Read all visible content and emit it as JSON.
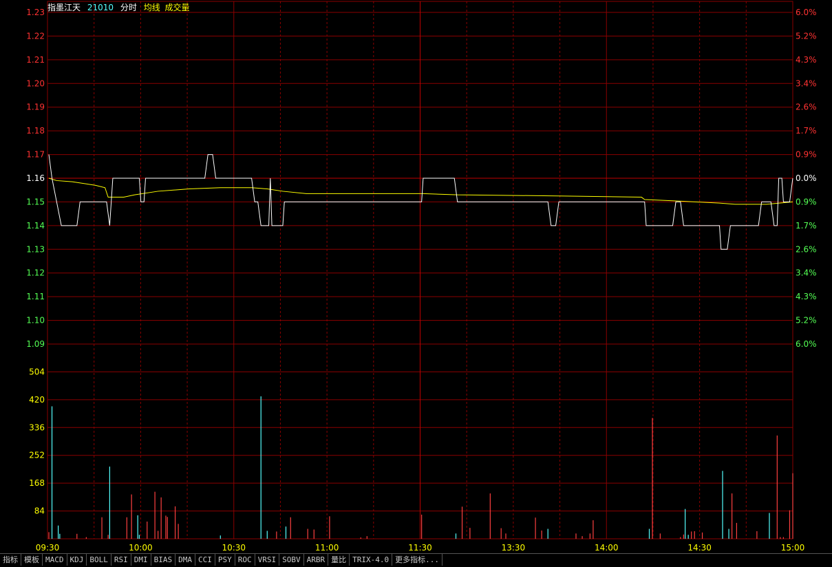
{
  "header": {
    "name": "指墨江天",
    "code": "21010",
    "mode": "分时",
    "avg_label": "均线",
    "vol_label": "成交量"
  },
  "colors": {
    "up": "#ff3232",
    "down": "#54ff54",
    "flat": "#ffffff",
    "grid": "#8b0000",
    "price_line": "#ffffff",
    "avg_line": "#ffff00",
    "vol_up": "#ff4040",
    "vol_down": "#54ffff",
    "vol_label": "#ffff00",
    "time_label": "#ffff00"
  },
  "toolbar": [
    "指标",
    "模板",
    "MACD",
    "KDJ",
    "BOLL",
    "RSI",
    "DMI",
    "BIAS",
    "DMA",
    "CCI",
    "PSY",
    "ROC",
    "VRSI",
    "SOBV",
    "ARBR",
    "量比",
    "TRIX-4.0",
    "更多指标..."
  ],
  "chart_data": {
    "type": "line",
    "title": "指墨江天 21010 分时",
    "prev_close": 1.16,
    "price_axis": {
      "ticks": [
        "1.23",
        "1.22",
        "1.21",
        "1.20",
        "1.19",
        "1.18",
        "1.17",
        "1.16",
        "1.15",
        "1.14",
        "1.13",
        "1.12",
        "1.11",
        "1.10",
        "1.09"
      ],
      "range": [
        1.09,
        1.23
      ]
    },
    "pct_axis": {
      "ticks": [
        "6.0%",
        "5.2%",
        "4.3%",
        "3.4%",
        "2.6%",
        "1.7%",
        "0.9%",
        "0.0%",
        "0.9%",
        "1.7%",
        "2.6%",
        "3.4%",
        "4.3%",
        "5.2%",
        "6.0%"
      ]
    },
    "volume_axis": {
      "ticks": [
        "504",
        "420",
        "336",
        "252",
        "168",
        "84"
      ],
      "range": [
        0,
        588
      ]
    },
    "time_labels": [
      "09:30",
      "10:00",
      "10:30",
      "11:00",
      "11:30",
      "13:30",
      "14:00",
      "14:30",
      "15:00"
    ],
    "price_points": [
      [
        0,
        1.17
      ],
      [
        2,
        1.16
      ],
      [
        5,
        1.15
      ],
      [
        8,
        1.14
      ],
      [
        18,
        1.14
      ],
      [
        20,
        1.15
      ],
      [
        37,
        1.15
      ],
      [
        39,
        1.14
      ],
      [
        41,
        1.16
      ],
      [
        58,
        1.16
      ],
      [
        59,
        1.15
      ],
      [
        61,
        1.15
      ],
      [
        62,
        1.16
      ],
      [
        100,
        1.16
      ],
      [
        102,
        1.17
      ],
      [
        105,
        1.17
      ],
      [
        107,
        1.16
      ],
      [
        130,
        1.16
      ],
      [
        132,
        1.15
      ],
      [
        134,
        1.15
      ],
      [
        136,
        1.14
      ],
      [
        141,
        1.14
      ],
      [
        142,
        1.16
      ],
      [
        143,
        1.14
      ],
      [
        150,
        1.14
      ],
      [
        151,
        1.15
      ],
      [
        157,
        1.15
      ],
      [
        158,
        1.15
      ],
      [
        239,
        1.15
      ],
      [
        240,
        1.16
      ],
      [
        260,
        1.16
      ],
      [
        262,
        1.15
      ],
      [
        320,
        1.15
      ],
      [
        322,
        1.14
      ],
      [
        325,
        1.14
      ],
      [
        327,
        1.15
      ],
      [
        382,
        1.15
      ],
      [
        383,
        1.14
      ],
      [
        400,
        1.14
      ],
      [
        402,
        1.15
      ],
      [
        405,
        1.15
      ],
      [
        407,
        1.14
      ],
      [
        430,
        1.14
      ],
      [
        431,
        1.13
      ],
      [
        435,
        1.13
      ],
      [
        437,
        1.14
      ],
      [
        455,
        1.14
      ],
      [
        457,
        1.15
      ],
      [
        463,
        1.15
      ],
      [
        465,
        1.14
      ],
      [
        467,
        1.14
      ],
      [
        468,
        1.16
      ],
      [
        470,
        1.16
      ],
      [
        471,
        1.15
      ],
      [
        475,
        1.15
      ],
      [
        477,
        1.16
      ]
    ],
    "avg_points": [
      [
        0,
        1.16
      ],
      [
        5,
        1.159
      ],
      [
        15,
        1.1585
      ],
      [
        30,
        1.157
      ],
      [
        36,
        1.156
      ],
      [
        38,
        1.152
      ],
      [
        48,
        1.152
      ],
      [
        55,
        1.153
      ],
      [
        70,
        1.1545
      ],
      [
        90,
        1.1555
      ],
      [
        110,
        1.156
      ],
      [
        130,
        1.156
      ],
      [
        140,
        1.1555
      ],
      [
        150,
        1.1545
      ],
      [
        165,
        1.1535
      ],
      [
        240,
        1.1535
      ],
      [
        262,
        1.153
      ],
      [
        330,
        1.1525
      ],
      [
        380,
        1.152
      ],
      [
        382,
        1.151
      ],
      [
        400,
        1.1505
      ],
      [
        430,
        1.1495
      ],
      [
        440,
        1.149
      ],
      [
        460,
        1.149
      ],
      [
        477,
        1.15
      ]
    ],
    "volume_bars": [
      [
        0,
        20,
        "up"
      ],
      [
        2,
        400,
        "down"
      ],
      [
        6,
        40,
        "down"
      ],
      [
        7,
        15,
        "down"
      ],
      [
        18,
        15,
        "up"
      ],
      [
        24,
        5,
        "up"
      ],
      [
        34,
        65,
        "up"
      ],
      [
        38,
        12,
        "up"
      ],
      [
        39,
        218,
        "down"
      ],
      [
        50,
        65,
        "up"
      ],
      [
        53,
        134,
        "up"
      ],
      [
        57,
        71,
        "down"
      ],
      [
        58,
        12,
        "down"
      ],
      [
        63,
        52,
        "up"
      ],
      [
        68,
        142,
        "up"
      ],
      [
        70,
        24,
        "up"
      ],
      [
        72,
        125,
        "up"
      ],
      [
        75,
        70,
        "up"
      ],
      [
        76,
        66,
        "up"
      ],
      [
        81,
        98,
        "up"
      ],
      [
        83,
        45,
        "up"
      ],
      [
        110,
        10,
        "down"
      ],
      [
        136,
        430,
        "down"
      ],
      [
        140,
        24,
        "down"
      ],
      [
        146,
        22,
        "up"
      ],
      [
        152,
        37,
        "down"
      ],
      [
        155,
        65,
        "up"
      ],
      [
        166,
        30,
        "up"
      ],
      [
        170,
        28,
        "up"
      ],
      [
        180,
        68,
        "up"
      ],
      [
        200,
        4,
        "up"
      ],
      [
        204,
        8,
        "up"
      ],
      [
        239,
        73,
        "up"
      ],
      [
        261,
        16,
        "down"
      ],
      [
        265,
        97,
        "up"
      ],
      [
        270,
        33,
        "up"
      ],
      [
        283,
        137,
        "up"
      ],
      [
        290,
        32,
        "up"
      ],
      [
        293,
        16,
        "up"
      ],
      [
        312,
        64,
        "up"
      ],
      [
        316,
        25,
        "up"
      ],
      [
        320,
        30,
        "down"
      ],
      [
        338,
        16,
        "up"
      ],
      [
        342,
        8,
        "up"
      ],
      [
        347,
        16,
        "up"
      ],
      [
        349,
        56,
        "up"
      ],
      [
        385,
        30,
        "down"
      ],
      [
        387,
        365,
        "up"
      ],
      [
        392,
        16,
        "up"
      ],
      [
        405,
        5,
        "up"
      ],
      [
        407,
        13,
        "up"
      ],
      [
        408,
        90,
        "down"
      ],
      [
        410,
        12,
        "down"
      ],
      [
        412,
        22,
        "up"
      ],
      [
        414,
        23,
        "up"
      ],
      [
        419,
        19,
        "up"
      ],
      [
        432,
        205,
        "down"
      ],
      [
        436,
        30,
        "down"
      ],
      [
        438,
        137,
        "up"
      ],
      [
        441,
        48,
        "up"
      ],
      [
        454,
        23,
        "up"
      ],
      [
        462,
        78,
        "down"
      ],
      [
        467,
        312,
        "up"
      ],
      [
        469,
        5,
        "up"
      ],
      [
        471,
        5,
        "up"
      ],
      [
        475,
        86,
        "up"
      ],
      [
        477,
        198,
        "up"
      ]
    ]
  }
}
